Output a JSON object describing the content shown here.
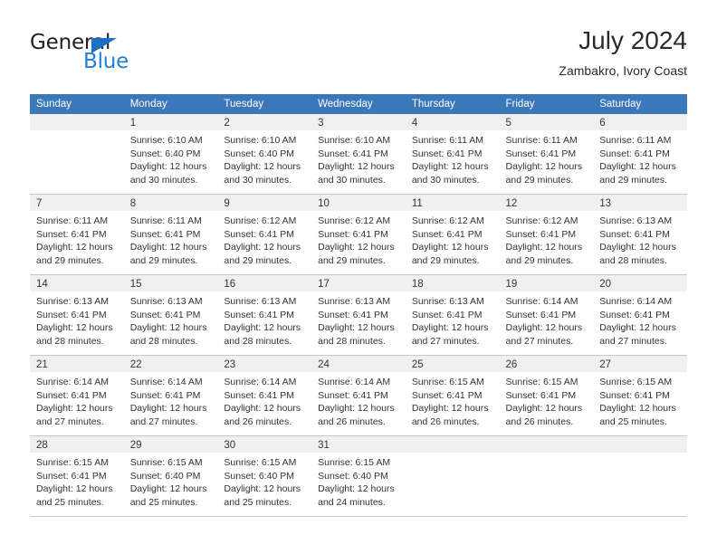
{
  "brand": {
    "name_top": "General",
    "name_bottom": "Blue",
    "triangle_color": "#1f6fc4",
    "blue_color": "#2081d0"
  },
  "header": {
    "title": "July 2024",
    "subtitle": "Zambakro, Ivory Coast",
    "header_bg": "#3b78b9",
    "band_bg": "#f0f0f0"
  },
  "weekday_headers": [
    "Sunday",
    "Monday",
    "Tuesday",
    "Wednesday",
    "Thursday",
    "Friday",
    "Saturday"
  ],
  "labels": {
    "sunrise_prefix": "Sunrise:",
    "sunset_prefix": "Sunset:",
    "daylight_prefix": "Daylight:"
  },
  "weeks": [
    [
      {
        "day": "",
        "empty": true
      },
      {
        "day": "1",
        "sunrise": "Sunrise: 6:10 AM",
        "sunset": "Sunset: 6:40 PM",
        "daylight": "Daylight: 12 hours and 30 minutes."
      },
      {
        "day": "2",
        "sunrise": "Sunrise: 6:10 AM",
        "sunset": "Sunset: 6:40 PM",
        "daylight": "Daylight: 12 hours and 30 minutes."
      },
      {
        "day": "3",
        "sunrise": "Sunrise: 6:10 AM",
        "sunset": "Sunset: 6:41 PM",
        "daylight": "Daylight: 12 hours and 30 minutes."
      },
      {
        "day": "4",
        "sunrise": "Sunrise: 6:11 AM",
        "sunset": "Sunset: 6:41 PM",
        "daylight": "Daylight: 12 hours and 30 minutes."
      },
      {
        "day": "5",
        "sunrise": "Sunrise: 6:11 AM",
        "sunset": "Sunset: 6:41 PM",
        "daylight": "Daylight: 12 hours and 29 minutes."
      },
      {
        "day": "6",
        "sunrise": "Sunrise: 6:11 AM",
        "sunset": "Sunset: 6:41 PM",
        "daylight": "Daylight: 12 hours and 29 minutes."
      }
    ],
    [
      {
        "day": "7",
        "sunrise": "Sunrise: 6:11 AM",
        "sunset": "Sunset: 6:41 PM",
        "daylight": "Daylight: 12 hours and 29 minutes."
      },
      {
        "day": "8",
        "sunrise": "Sunrise: 6:11 AM",
        "sunset": "Sunset: 6:41 PM",
        "daylight": "Daylight: 12 hours and 29 minutes."
      },
      {
        "day": "9",
        "sunrise": "Sunrise: 6:12 AM",
        "sunset": "Sunset: 6:41 PM",
        "daylight": "Daylight: 12 hours and 29 minutes."
      },
      {
        "day": "10",
        "sunrise": "Sunrise: 6:12 AM",
        "sunset": "Sunset: 6:41 PM",
        "daylight": "Daylight: 12 hours and 29 minutes."
      },
      {
        "day": "11",
        "sunrise": "Sunrise: 6:12 AM",
        "sunset": "Sunset: 6:41 PM",
        "daylight": "Daylight: 12 hours and 29 minutes."
      },
      {
        "day": "12",
        "sunrise": "Sunrise: 6:12 AM",
        "sunset": "Sunset: 6:41 PM",
        "daylight": "Daylight: 12 hours and 29 minutes."
      },
      {
        "day": "13",
        "sunrise": "Sunrise: 6:13 AM",
        "sunset": "Sunset: 6:41 PM",
        "daylight": "Daylight: 12 hours and 28 minutes."
      }
    ],
    [
      {
        "day": "14",
        "sunrise": "Sunrise: 6:13 AM",
        "sunset": "Sunset: 6:41 PM",
        "daylight": "Daylight: 12 hours and 28 minutes."
      },
      {
        "day": "15",
        "sunrise": "Sunrise: 6:13 AM",
        "sunset": "Sunset: 6:41 PM",
        "daylight": "Daylight: 12 hours and 28 minutes."
      },
      {
        "day": "16",
        "sunrise": "Sunrise: 6:13 AM",
        "sunset": "Sunset: 6:41 PM",
        "daylight": "Daylight: 12 hours and 28 minutes."
      },
      {
        "day": "17",
        "sunrise": "Sunrise: 6:13 AM",
        "sunset": "Sunset: 6:41 PM",
        "daylight": "Daylight: 12 hours and 28 minutes."
      },
      {
        "day": "18",
        "sunrise": "Sunrise: 6:13 AM",
        "sunset": "Sunset: 6:41 PM",
        "daylight": "Daylight: 12 hours and 27 minutes."
      },
      {
        "day": "19",
        "sunrise": "Sunrise: 6:14 AM",
        "sunset": "Sunset: 6:41 PM",
        "daylight": "Daylight: 12 hours and 27 minutes."
      },
      {
        "day": "20",
        "sunrise": "Sunrise: 6:14 AM",
        "sunset": "Sunset: 6:41 PM",
        "daylight": "Daylight: 12 hours and 27 minutes."
      }
    ],
    [
      {
        "day": "21",
        "sunrise": "Sunrise: 6:14 AM",
        "sunset": "Sunset: 6:41 PM",
        "daylight": "Daylight: 12 hours and 27 minutes."
      },
      {
        "day": "22",
        "sunrise": "Sunrise: 6:14 AM",
        "sunset": "Sunset: 6:41 PM",
        "daylight": "Daylight: 12 hours and 27 minutes."
      },
      {
        "day": "23",
        "sunrise": "Sunrise: 6:14 AM",
        "sunset": "Sunset: 6:41 PM",
        "daylight": "Daylight: 12 hours and 26 minutes."
      },
      {
        "day": "24",
        "sunrise": "Sunrise: 6:14 AM",
        "sunset": "Sunset: 6:41 PM",
        "daylight": "Daylight: 12 hours and 26 minutes."
      },
      {
        "day": "25",
        "sunrise": "Sunrise: 6:15 AM",
        "sunset": "Sunset: 6:41 PM",
        "daylight": "Daylight: 12 hours and 26 minutes."
      },
      {
        "day": "26",
        "sunrise": "Sunrise: 6:15 AM",
        "sunset": "Sunset: 6:41 PM",
        "daylight": "Daylight: 12 hours and 26 minutes."
      },
      {
        "day": "27",
        "sunrise": "Sunrise: 6:15 AM",
        "sunset": "Sunset: 6:41 PM",
        "daylight": "Daylight: 12 hours and 25 minutes."
      }
    ],
    [
      {
        "day": "28",
        "sunrise": "Sunrise: 6:15 AM",
        "sunset": "Sunset: 6:41 PM",
        "daylight": "Daylight: 12 hours and 25 minutes."
      },
      {
        "day": "29",
        "sunrise": "Sunrise: 6:15 AM",
        "sunset": "Sunset: 6:40 PM",
        "daylight": "Daylight: 12 hours and 25 minutes."
      },
      {
        "day": "30",
        "sunrise": "Sunrise: 6:15 AM",
        "sunset": "Sunset: 6:40 PM",
        "daylight": "Daylight: 12 hours and 25 minutes."
      },
      {
        "day": "31",
        "sunrise": "Sunrise: 6:15 AM",
        "sunset": "Sunset: 6:40 PM",
        "daylight": "Daylight: 12 hours and 24 minutes."
      },
      {
        "day": "",
        "empty": true
      },
      {
        "day": "",
        "empty": true
      },
      {
        "day": "",
        "empty": true
      }
    ]
  ]
}
